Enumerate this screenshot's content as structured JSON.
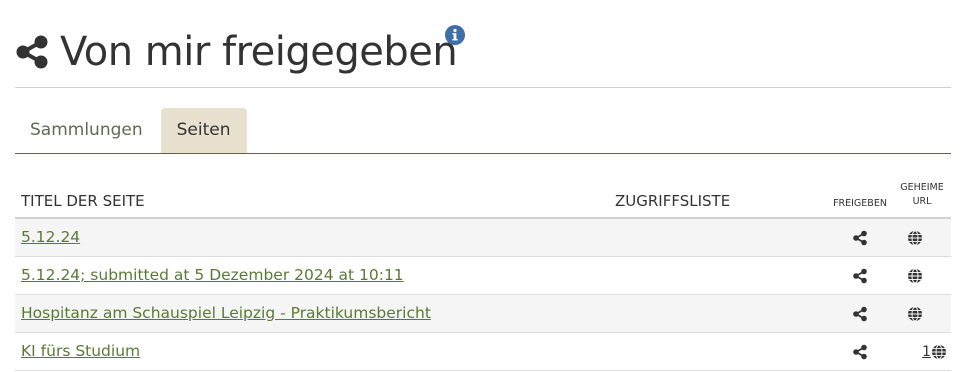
{
  "header": {
    "title": "Von mir freigegeben",
    "icon": "share-icon",
    "info_icon": "info-icon",
    "info_color": "#3f6fa8"
  },
  "tabs": [
    {
      "label": "Sammlungen",
      "active": false
    },
    {
      "label": "Seiten",
      "active": true
    }
  ],
  "table": {
    "columns": {
      "title": "TITEL DER SEITE",
      "access": "ZUGRIFFSLISTE",
      "share": "FREIGEBEN",
      "secret": "GEHEIME URL"
    },
    "secret_lines": [
      "GEHEIME",
      "URL"
    ],
    "rows": [
      {
        "title": "5.12.24",
        "share_icon": "share-icon",
        "secret_icon": "globe-icon",
        "secret_count": ""
      },
      {
        "title": "5.12.24; submitted at 5 Dezember 2024 at 10:11",
        "share_icon": "share-icon",
        "secret_icon": "globe-icon",
        "secret_count": ""
      },
      {
        "title": "Hospitanz am Schauspiel Leipzig - Praktikumsbericht",
        "share_icon": "share-icon",
        "secret_icon": "globe-icon",
        "secret_count": ""
      },
      {
        "title": "KI fürs Studium",
        "share_icon": "share-icon",
        "secret_icon": "globe-icon",
        "secret_count": "1"
      }
    ]
  },
  "colors": {
    "link": "#5a7a34",
    "tab_active_bg": "#e8e1d0",
    "tab_line": "#6a5f45"
  }
}
